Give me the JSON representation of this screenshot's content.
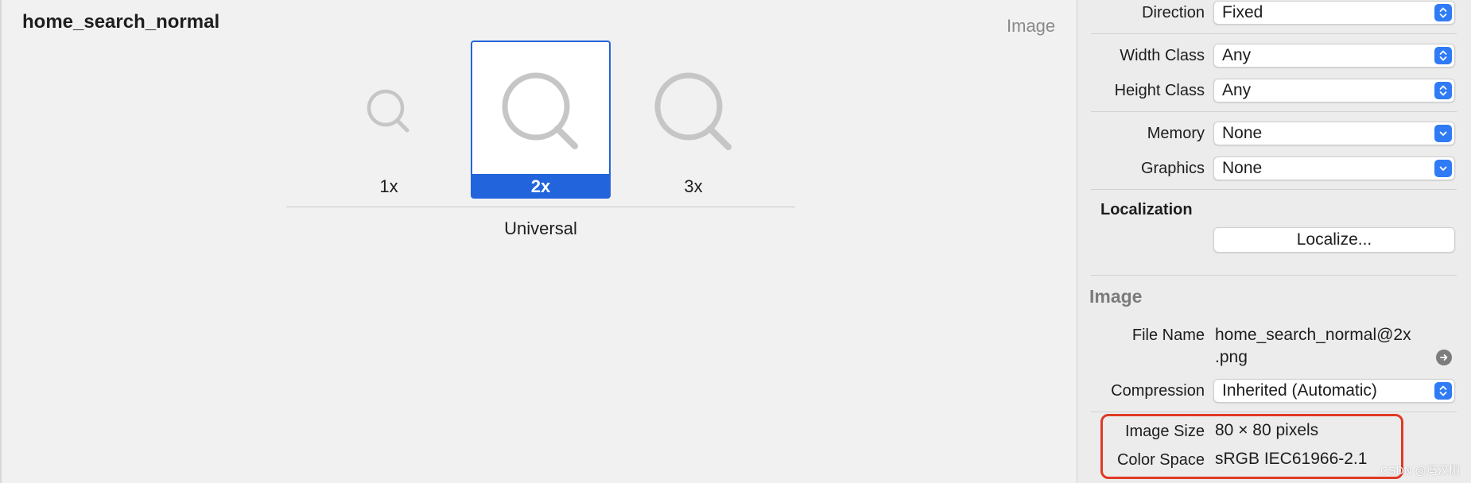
{
  "asset": {
    "name": "home_search_normal",
    "type_label": "Image",
    "slots": [
      {
        "label": "1x",
        "icon": "magnifier-icon",
        "selected": false
      },
      {
        "label": "2x",
        "icon": "magnifier-icon",
        "selected": true
      },
      {
        "label": "3x",
        "icon": "magnifier-icon",
        "selected": false
      }
    ],
    "idiom": "Universal"
  },
  "inspector": {
    "direction": {
      "label": "Direction",
      "value": "Fixed"
    },
    "width_class": {
      "label": "Width Class",
      "value": "Any"
    },
    "height_class": {
      "label": "Height Class",
      "value": "Any"
    },
    "memory": {
      "label": "Memory",
      "value": "None"
    },
    "graphics": {
      "label": "Graphics",
      "value": "None"
    },
    "localization": {
      "title": "Localization",
      "button": "Localize..."
    },
    "image": {
      "title": "Image",
      "file_name_label": "File Name",
      "file_name_line1": "home_search_normal@2x",
      "file_name_line2": ".png",
      "compression_label": "Compression",
      "compression_value": "Inherited (Automatic)",
      "image_size_label": "Image Size",
      "image_size_value": "80 × 80 pixels",
      "color_space_label": "Color Space",
      "color_space_value": "sRGB IEC61966-2.1"
    }
  },
  "watermark": "CSDN @冯汉栩",
  "colors": {
    "selection_blue": "#2264dc",
    "popup_stepper": "#2f7bf5",
    "highlight_red": "#e03a25",
    "icon_gray": "#c6c6c6"
  }
}
